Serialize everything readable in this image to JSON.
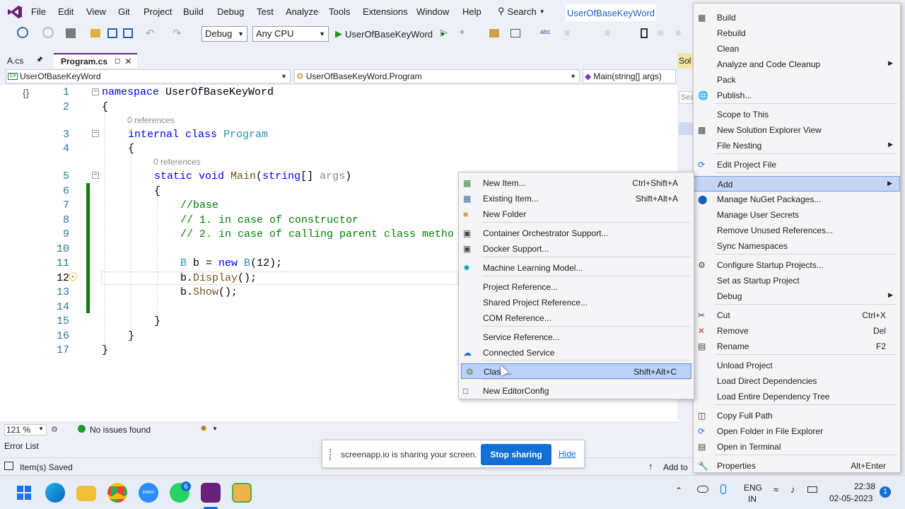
{
  "menubar": {
    "items": [
      "File",
      "Edit",
      "View",
      "Git",
      "Project",
      "Build",
      "Debug",
      "Test",
      "Analyze",
      "Tools",
      "Extensions",
      "Window",
      "Help"
    ],
    "search": "Search",
    "solution_title": "UserOfBaseKeyWord"
  },
  "toolbar": {
    "config": "Debug",
    "platform": "Any CPU",
    "start_target": "UserOfBaseKeyWord"
  },
  "tabs": [
    {
      "label": "A.cs"
    },
    {
      "label": "Program.cs"
    }
  ],
  "navbar": {
    "project": "UserOfBaseKeyWord",
    "type": "UserOfBaseKeyWord.Program",
    "member": "Main(string[] args)"
  },
  "editor": {
    "lines": [
      "1",
      "2",
      "3",
      "4",
      "5",
      "6",
      "7",
      "8",
      "9",
      "10",
      "11",
      "12",
      "13",
      "14",
      "15",
      "16",
      "17"
    ],
    "refs": [
      "0 references",
      "0 references"
    ],
    "code": {
      "l1_kw": "namespace",
      "l1_name": " UserOfBaseKeyWord",
      "l2": "{",
      "l3_kw": "internal class",
      "l3_ty": " Program",
      "l4": "{",
      "l5_kw": "static void",
      "l5_mt": " Main",
      "l5_p1": "(",
      "l5_kw2": "string",
      "l5_p2": "[] ",
      "l5_dim": "args",
      "l5_p3": ")",
      "l6": "{",
      "l7": "//base",
      "l8": "// 1. in case of constructor",
      "l9": "// 2. in case of calling parent class metho",
      "l11_ty": "B",
      "l11_a": " b = ",
      "l11_kw": "new",
      "l11_ty2": " B",
      "l11_b": "(12);",
      "l12_a": "b.",
      "l12_mt": "Display",
      "l12_b": "();",
      "l13_a": "b.",
      "l13_mt": "Show",
      "l13_b": "();",
      "l15": "}",
      "l16": "}",
      "l17": "}"
    }
  },
  "editor_status": {
    "zoom": "121 %",
    "issues": "No issues found"
  },
  "error_list": "Error List",
  "status": {
    "saved": "Item(s) Saved",
    "add_to": "Add to"
  },
  "share_banner": {
    "text": "screenapp.io is sharing your screen.",
    "stop": "Stop sharing",
    "hide": "Hide"
  },
  "solex": {
    "title": "Sol",
    "search": "Sea"
  },
  "project_menu": {
    "items": [
      {
        "label": "Build",
        "shortcut": "",
        "icon": "build-icon"
      },
      {
        "label": "Rebuild",
        "shortcut": ""
      },
      {
        "label": "Clean",
        "shortcut": ""
      },
      {
        "label": "Analyze and Code Cleanup",
        "shortcut": "",
        "submenu": true
      },
      {
        "label": "Pack",
        "shortcut": ""
      },
      {
        "label": "Publish...",
        "shortcut": "",
        "icon": "globe-icon"
      },
      {
        "label": "Scope to This",
        "shortcut": ""
      },
      {
        "label": "New Solution Explorer View",
        "shortcut": "",
        "icon": "window-icon"
      },
      {
        "label": "File Nesting",
        "shortcut": "",
        "submenu": true
      },
      {
        "label": "Edit Project File",
        "shortcut": "",
        "icon": "edit-icon"
      },
      {
        "label": "Add",
        "shortcut": "",
        "submenu": true
      },
      {
        "label": "Manage NuGet Packages...",
        "shortcut": "",
        "icon": "nuget-icon"
      },
      {
        "label": "Manage User Secrets",
        "shortcut": ""
      },
      {
        "label": "Remove Unused References...",
        "shortcut": ""
      },
      {
        "label": "Sync Namespaces",
        "shortcut": ""
      },
      {
        "label": "Configure Startup Projects...",
        "shortcut": "",
        "icon": "gear-icon"
      },
      {
        "label": "Set as Startup Project",
        "shortcut": ""
      },
      {
        "label": "Debug",
        "shortcut": "",
        "submenu": true
      },
      {
        "label": "Cut",
        "shortcut": "Ctrl+X",
        "icon": "scissors-icon"
      },
      {
        "label": "Remove",
        "shortcut": "Del",
        "icon": "remove-icon"
      },
      {
        "label": "Rename",
        "shortcut": "F2",
        "icon": "rename-icon"
      },
      {
        "label": "Unload Project",
        "shortcut": ""
      },
      {
        "label": "Load Direct Dependencies",
        "shortcut": ""
      },
      {
        "label": "Load Entire Dependency Tree",
        "shortcut": ""
      },
      {
        "label": "Copy Full Path",
        "shortcut": "",
        "icon": "copy-icon"
      },
      {
        "label": "Open Folder in File Explorer",
        "shortcut": "",
        "icon": "refresh-icon"
      },
      {
        "label": "Open in Terminal",
        "shortcut": "",
        "icon": "terminal-icon"
      },
      {
        "label": "Properties",
        "shortcut": "Alt+Enter",
        "icon": "wrench-icon"
      }
    ]
  },
  "add_menu": {
    "items": [
      {
        "label": "New Item...",
        "shortcut": "Ctrl+Shift+A",
        "icon": "new-item-icon"
      },
      {
        "label": "Existing Item...",
        "shortcut": "Shift+Alt+A",
        "icon": "existing-item-icon"
      },
      {
        "label": "New Folder",
        "shortcut": "",
        "icon": "folder-icon"
      },
      {
        "label": "Container Orchestrator Support...",
        "shortcut": "",
        "icon": "container-icon"
      },
      {
        "label": "Docker Support...",
        "shortcut": "",
        "icon": "docker-icon"
      },
      {
        "label": "Machine Learning Model...",
        "shortcut": "",
        "icon": "ml-icon"
      },
      {
        "label": "Project Reference...",
        "shortcut": ""
      },
      {
        "label": "Shared Project Reference...",
        "shortcut": ""
      },
      {
        "label": "COM Reference...",
        "shortcut": ""
      },
      {
        "label": "Service Reference...",
        "shortcut": ""
      },
      {
        "label": "Connected Service",
        "shortcut": "",
        "icon": "connected-service-icon"
      },
      {
        "label": "Class...",
        "shortcut": "Shift+Alt+C",
        "icon": "class-icon"
      },
      {
        "label": "New EditorConfig",
        "shortcut": "",
        "icon": "editorconfig-icon"
      }
    ]
  },
  "tray": {
    "lang1": "ENG",
    "lang2": "IN",
    "time": "22:38",
    "date": "02-05-2023",
    "notif": "1",
    "whatsapp_badge": "6"
  },
  "colors": {
    "accent": "#1170d4",
    "highlight": "#c7d5f5",
    "vs_purple": "#68217a"
  }
}
